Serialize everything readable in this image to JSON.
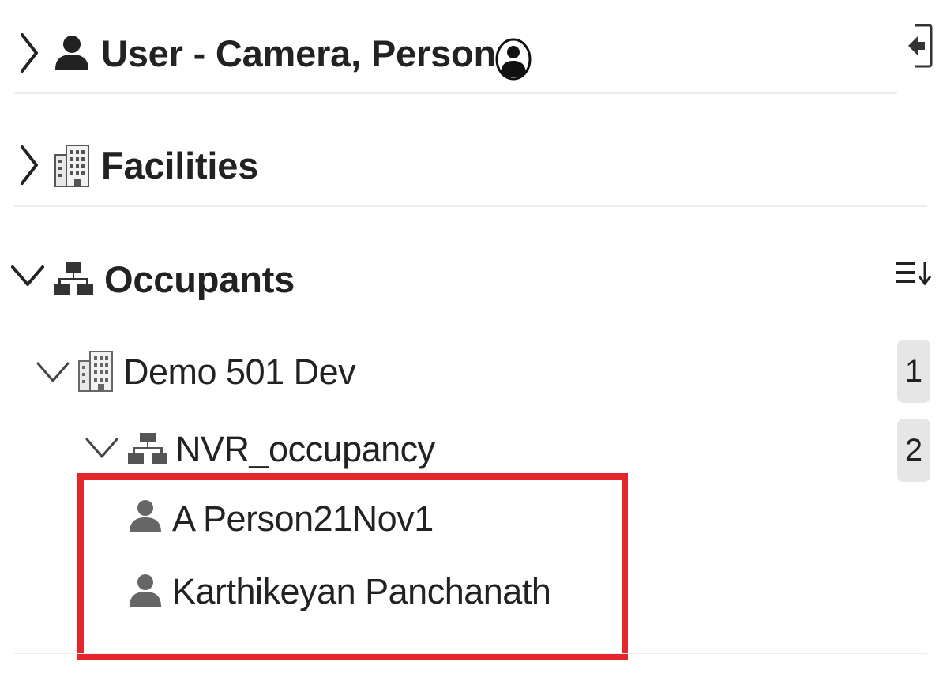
{
  "sections": {
    "user": {
      "title": "User - Camera, Person",
      "expanded": false
    },
    "facilities": {
      "title": "Facilities",
      "expanded": false
    },
    "occupants": {
      "title": "Occupants",
      "expanded": true,
      "tree": {
        "building": {
          "label": "Demo 501 Dev",
          "count": "1",
          "expanded": true
        },
        "network": {
          "label": "NVR_occupancy",
          "count": "2",
          "expanded": true
        },
        "people": [
          {
            "label": "A Person21Nov1"
          },
          {
            "label": "Karthikeyan Panchanath"
          }
        ]
      }
    }
  },
  "icons": {
    "user": "user-icon",
    "avatar": "avatar-circle-icon",
    "logout": "sign-out-icon",
    "building": "building-icon",
    "network": "sitemap-icon",
    "sort": "sort-list-icon",
    "chevron_right": "chevron-right-icon",
    "chevron_down": "chevron-down-icon"
  },
  "colors": {
    "highlight": "#e4262d",
    "badge_bg": "#e6e6e6",
    "person_icon": "#666666"
  }
}
